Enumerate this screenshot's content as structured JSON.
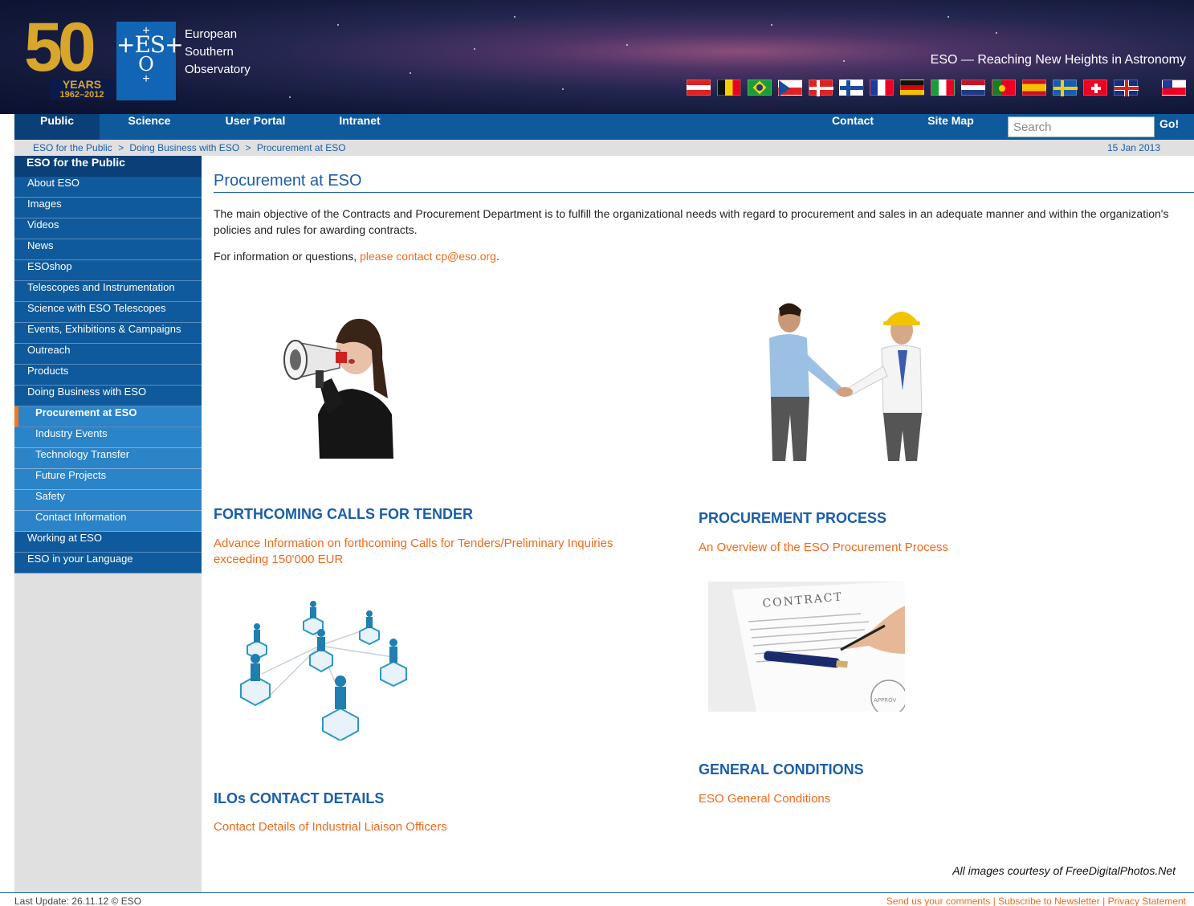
{
  "header": {
    "logo_50": "50",
    "logo_years": "YEARS",
    "logo_years_range": "1962–2012",
    "logo_eso": "ES",
    "org_name_line1": "European",
    "org_name_line2": "Southern",
    "org_name_line3": "Observatory",
    "tagline": "ESO — Reaching New Heights in Astronomy",
    "flags": [
      "austria-flag",
      "belgium-flag",
      "brazil-flag",
      "czech-flag",
      "denmark-flag",
      "finland-flag",
      "france-flag",
      "germany-flag",
      "italy-flag",
      "netherlands-flag",
      "portugal-flag",
      "spain-flag",
      "sweden-flag",
      "switzerland-flag",
      "uk-flag",
      "chile-flag"
    ]
  },
  "nav": {
    "public": "Public",
    "science": "Science",
    "user_portal": "User Portal",
    "intranet": "Intranet",
    "contact": "Contact",
    "site_map": "Site Map",
    "search_placeholder": "Search",
    "go": "Go!"
  },
  "breadcrumb": {
    "items": [
      "ESO for the Public",
      "Doing Business with ESO",
      "Procurement at ESO"
    ],
    "separator": ">",
    "date": "15 Jan 2013"
  },
  "sidebar": {
    "heading": "ESO for the Public",
    "items": [
      "About ESO",
      "Images",
      "Videos",
      "News",
      "ESOshop",
      "Telescopes and Instrumentation",
      "Science with ESO Telescopes",
      "Events, Exhibitions & Campaigns",
      "Outreach",
      "Products",
      "Doing Business with ESO"
    ],
    "active": "Procurement at ESO",
    "subitems": [
      "Industry Events",
      "Technology Transfer",
      "Future Projects",
      "Safety",
      "Contact Information"
    ],
    "bottom_items": [
      "Working at ESO",
      "ESO in your Language"
    ]
  },
  "main": {
    "title": "Procurement at ESO",
    "intro": "The main objective of the Contracts and Procurement Department is to fulfill the organizational needs with regard to procurement and sales in an adequate manner and within the organization's policies and rules for awarding contracts.",
    "contact_prefix": "For information or questions, ",
    "contact_link": "please contact cp@eso.org",
    "contact_suffix": ".",
    "sections": {
      "tender_heading": "FORTHCOMING CALLS FOR TENDER",
      "tender_link": "Advance Information on forthcoming Calls for Tenders/Preliminary Inquiries exceeding 150'000 EUR",
      "process_heading": "PROCUREMENT PROCESS",
      "process_link": "An Overview of the ESO Procurement Process",
      "ilo_heading": "ILOs CONTACT DETAILS",
      "ilo_link": "Contact Details of Industrial Liaison Officers",
      "conditions_heading": "GENERAL CONDITIONS",
      "conditions_link": "ESO General Conditions"
    },
    "contract_text": "CONTRACT",
    "approved_text": "APPROV",
    "courtesy": "All images courtesy of FreeDigitalPhotos.Net"
  },
  "footer": {
    "last_update": "Last Update: 26.11.12 © ESO",
    "send_comments": "Send us your comments",
    "subscribe": "Subscribe to Newsletter",
    "privacy": "Privacy Statement",
    "separator": "|"
  },
  "colors": {
    "nav_blue": "#0f5a9c",
    "nav_active": "#0a3f78",
    "sub_blue": "#2b83c8",
    "link_orange": "#ee6a1c",
    "heading_blue": "#1a5ea8",
    "logo_gold": "#d8a62a"
  }
}
